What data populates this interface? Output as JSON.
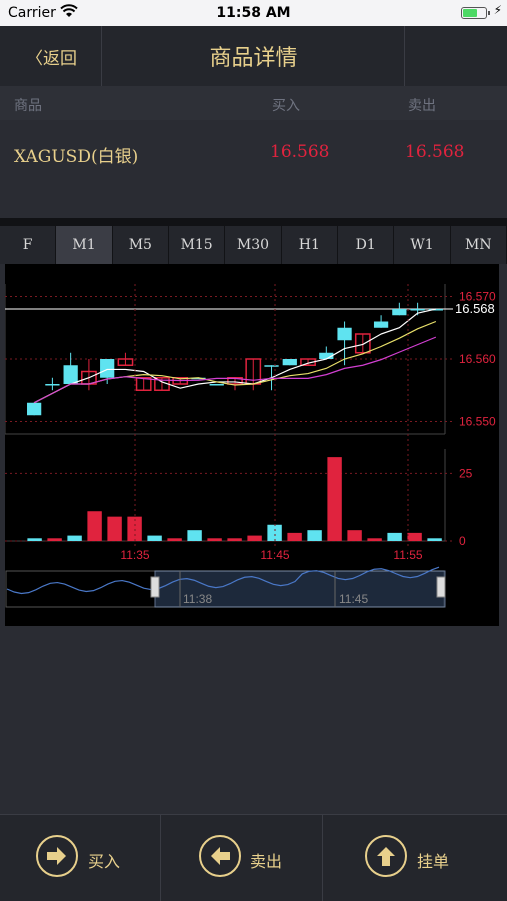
{
  "status": {
    "carrier": "Carrier",
    "time": "11:58 AM"
  },
  "nav": {
    "back": "〈返回",
    "title": "商品详情"
  },
  "table": {
    "headers": [
      "商品",
      "买入",
      "卖出"
    ],
    "symbol": "XAGUSD(白银)",
    "buy": "16.568",
    "sell": "16.568"
  },
  "tabs": [
    "F",
    "M1",
    "M5",
    "M15",
    "M30",
    "H1",
    "D1",
    "W1",
    "MN"
  ],
  "active_tab": "M1",
  "bottom": {
    "buy": "买入",
    "sell": "卖出",
    "order": "挂单"
  },
  "colors": {
    "accent": "#e8d08c",
    "up": "#5fe3f0",
    "down": "#e0233e"
  },
  "chart_data": {
    "type": "candlestick",
    "price_axis": [
      "16.570",
      "16.560",
      "16.550"
    ],
    "last_price": "16.568",
    "volume_axis": [
      "25",
      "0"
    ],
    "time_labels": [
      "11:35",
      "11:45",
      "11:55"
    ],
    "navigator_labels": [
      "11:38",
      "11:45"
    ],
    "ylim": [
      16.548,
      16.572
    ],
    "candles": [
      {
        "o": 16.551,
        "c": 16.553,
        "h": 16.553,
        "l": 16.551
      },
      {
        "o": 16.556,
        "c": 16.556,
        "h": 16.557,
        "l": 16.555
      },
      {
        "o": 16.556,
        "c": 16.559,
        "h": 16.561,
        "l": 16.556
      },
      {
        "o": 16.558,
        "c": 16.556,
        "h": 16.56,
        "l": 16.555
      },
      {
        "o": 16.557,
        "c": 16.56,
        "h": 16.56,
        "l": 16.556
      },
      {
        "o": 16.56,
        "c": 16.559,
        "h": 16.561,
        "l": 16.559
      },
      {
        "o": 16.557,
        "c": 16.555,
        "h": 16.557,
        "l": 16.555
      },
      {
        "o": 16.557,
        "c": 16.555,
        "h": 16.557,
        "l": 16.555
      },
      {
        "o": 16.557,
        "c": 16.556,
        "h": 16.557,
        "l": 16.556
      },
      {
        "o": 16.557,
        "c": 16.557,
        "h": 16.557,
        "l": 16.557
      },
      {
        "o": 16.556,
        "c": 16.556,
        "h": 16.556,
        "l": 16.556
      },
      {
        "o": 16.557,
        "c": 16.556,
        "h": 16.557,
        "l": 16.555
      },
      {
        "o": 16.56,
        "c": 16.556,
        "h": 16.56,
        "l": 16.555
      },
      {
        "o": 16.559,
        "c": 16.559,
        "h": 16.559,
        "l": 16.555
      },
      {
        "o": 16.559,
        "c": 16.56,
        "h": 16.56,
        "l": 16.559
      },
      {
        "o": 16.56,
        "c": 16.559,
        "h": 16.56,
        "l": 16.559
      },
      {
        "o": 16.56,
        "c": 16.561,
        "h": 16.562,
        "l": 16.56
      },
      {
        "o": 16.563,
        "c": 16.565,
        "h": 16.566,
        "l": 16.559
      },
      {
        "o": 16.564,
        "c": 16.561,
        "h": 16.564,
        "l": 16.561
      },
      {
        "o": 16.565,
        "c": 16.566,
        "h": 16.567,
        "l": 16.565
      },
      {
        "o": 16.567,
        "c": 16.568,
        "h": 16.569,
        "l": 16.567
      },
      {
        "o": 16.568,
        "c": 16.568,
        "h": 16.569,
        "l": 16.567
      },
      {
        "o": 16.568,
        "c": 16.568,
        "h": 16.568,
        "l": 16.568
      }
    ],
    "volumes": [
      1,
      1,
      2,
      11,
      9,
      9,
      2,
      1,
      4,
      1,
      1,
      2,
      6,
      3,
      4,
      31,
      4,
      1,
      3,
      3,
      1
    ]
  }
}
